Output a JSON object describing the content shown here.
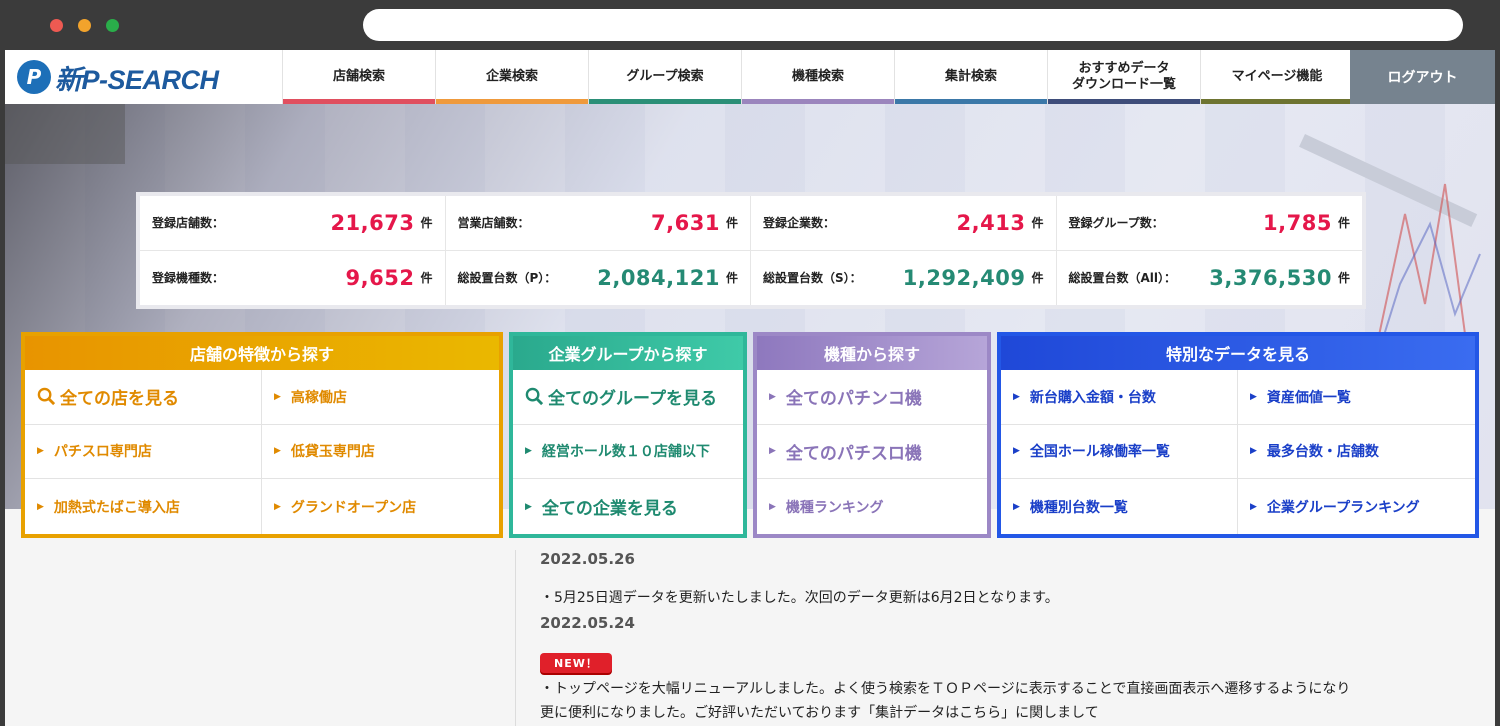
{
  "header": {
    "logo_text": "新P-SEARCH",
    "nav": [
      {
        "label": "店舗検索",
        "color": "#e04f5f"
      },
      {
        "label": "企業検索",
        "color": "#ef9a3c"
      },
      {
        "label": "グループ検索",
        "color": "#2b8f77"
      },
      {
        "label": "機種検索",
        "color": "#9b85bd"
      },
      {
        "label": "集計検索",
        "color": "#3b78a8"
      },
      {
        "label": "おすすめデータ\nダウンロード一覧",
        "color": "#3e4d7a"
      },
      {
        "label": "マイページ機能",
        "color": "#6e7431"
      }
    ],
    "logout_label": "ログアウト"
  },
  "stats": [
    {
      "label": "登録店舗数：",
      "value": "21,673",
      "unit": "件",
      "color": "red"
    },
    {
      "label": "営業店舗数：",
      "value": "7,631",
      "unit": "件",
      "color": "red"
    },
    {
      "label": "登録企業数：",
      "value": "2,413",
      "unit": "件",
      "color": "red"
    },
    {
      "label": "登録グループ数：",
      "value": "1,785",
      "unit": "件",
      "color": "red"
    },
    {
      "label": "登録機種数：",
      "value": "9,652",
      "unit": "件",
      "color": "red"
    },
    {
      "label": "総設置台数（P）：",
      "value": "2,084,121",
      "unit": "件",
      "color": "green"
    },
    {
      "label": "総設置台数（S）：",
      "value": "1,292,409",
      "unit": "件",
      "color": "green"
    },
    {
      "label": "総設置台数（All）：",
      "value": "3,376,530",
      "unit": "件",
      "color": "green"
    }
  ],
  "panels": {
    "store": {
      "title": "店舗の特徴から探す",
      "items": [
        "全ての店を見る",
        "高稼働店",
        "パチスロ専門店",
        "低貸玉専門店",
        "加熱式たばこ導入店",
        "グランドオープン店"
      ]
    },
    "group": {
      "title": "企業グループから探す",
      "items": [
        "全てのグループを見る",
        "経営ホール数１０店舗以下",
        "全ての企業を見る"
      ]
    },
    "machine": {
      "title": "機種から探す",
      "items": [
        "全てのパチンコ機",
        "全てのパチスロ機",
        "機種ランキング"
      ]
    },
    "special": {
      "title": "特別なデータを見る",
      "items": [
        "新台購入金額・台数",
        "資産価値一覧",
        "全国ホール稼働率一覧",
        "最多台数・店舗数",
        "機種別台数一覧",
        "企業グループランキング"
      ]
    }
  },
  "news": [
    {
      "date": "2022.05.26",
      "text": "・5月25日週データを更新いたしました。次回のデータ更新は6月2日となります。"
    },
    {
      "date": "2022.05.24",
      "badge": "NEW！",
      "text": "・トップページを大幅リニューアルしました。よく使う検索をＴＯＰページに表示することで直接画面表示へ遷移するようになり更に便利になりました。ご好評いただいております「集計データはこちら」に関しまして"
    }
  ],
  "colors": {
    "stat_red": "#e5174a",
    "stat_green": "#258a74",
    "store_panel": "#e8a100",
    "group_panel": "#2fb79a",
    "machine_panel": "#9c88c6",
    "special_panel": "#2357e6",
    "logout_bg": "#76838f"
  }
}
